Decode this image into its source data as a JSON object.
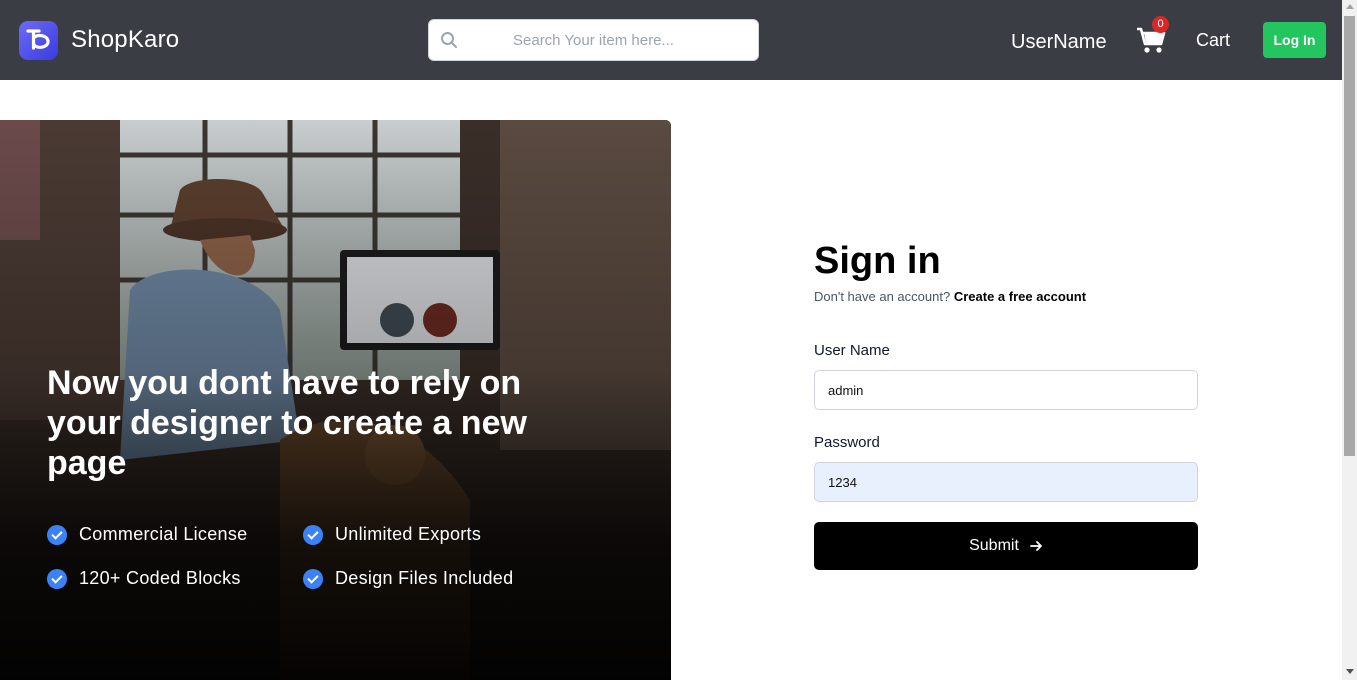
{
  "header": {
    "brand": "ShopKaro",
    "search_placeholder": "Search Your item here...",
    "username": "UserName",
    "cart_count": "0",
    "cart_label": "Cart",
    "login_label": "Log In"
  },
  "hero": {
    "title": "Now you dont have to rely on your designer to create a new page",
    "features": [
      "Commercial License",
      "Unlimited Exports",
      "120+ Coded Blocks",
      "Design Files Included"
    ]
  },
  "signin": {
    "title": "Sign in",
    "subtitle": "Don't have an account?",
    "create_link": "Create a free account",
    "username_label": "User Name",
    "username_value": "admin",
    "password_label": "Password",
    "password_value": "1234",
    "submit_label": "Submit"
  },
  "colors": {
    "header_bg": "#3b3d44",
    "login_green": "#22c55e",
    "badge_red": "#dc2626",
    "check_blue": "#3b82f6",
    "autofill_bg": "#e8f0fe"
  }
}
